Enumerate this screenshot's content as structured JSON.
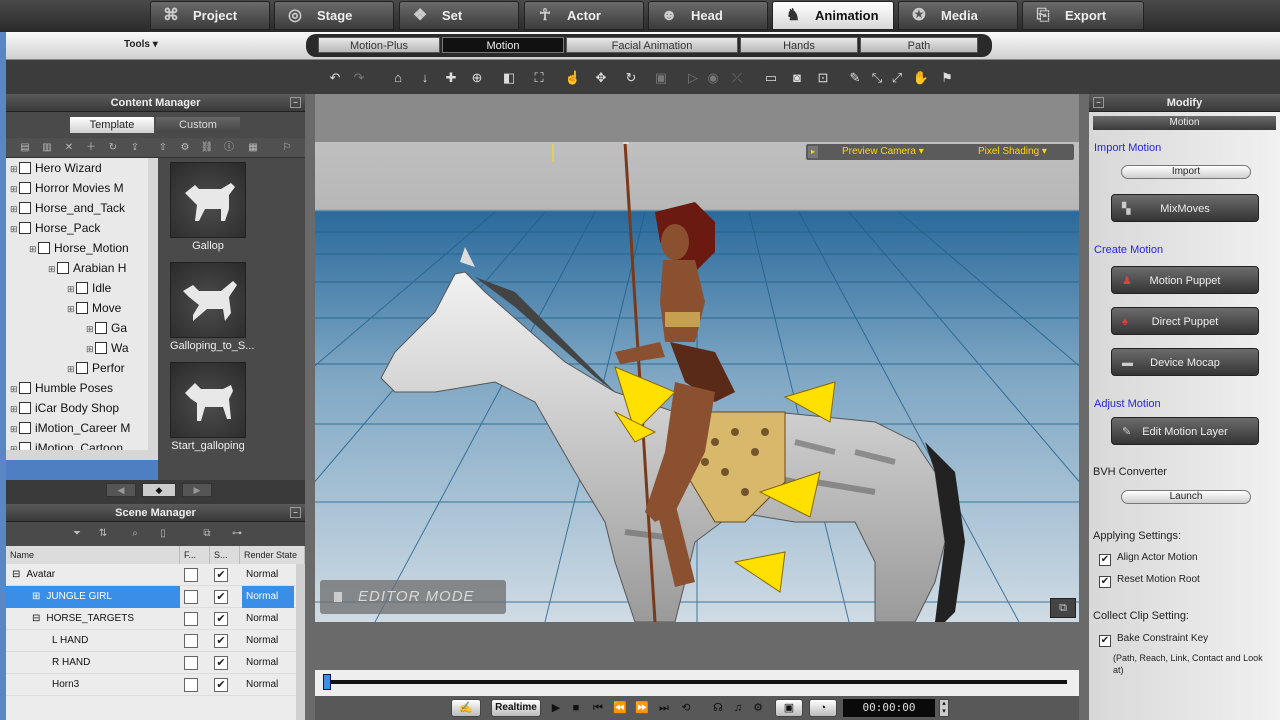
{
  "main_tabs": [
    {
      "label": "Project",
      "icon": "project-icon",
      "glyph": "⌘"
    },
    {
      "label": "Stage",
      "icon": "stage-icon",
      "glyph": "◎"
    },
    {
      "label": "Set",
      "icon": "set-icon",
      "glyph": "❖"
    },
    {
      "label": "Actor",
      "icon": "actor-icon",
      "glyph": "☥"
    },
    {
      "label": "Head",
      "icon": "head-icon",
      "glyph": "☻"
    },
    {
      "label": "Animation",
      "icon": "animation-icon",
      "glyph": "♞"
    },
    {
      "label": "Media",
      "icon": "media-icon",
      "glyph": "✪"
    },
    {
      "label": "Export",
      "icon": "export-icon",
      "glyph": "⎘"
    }
  ],
  "tools_label": "Tools ▾",
  "sub_tabs": [
    "Motion-Plus",
    "Motion",
    "Facial Animation",
    "Hands",
    "Path"
  ],
  "toolbar_icons": [
    {
      "name": "undo-icon",
      "glyph": "↶"
    },
    {
      "name": "redo-icon",
      "glyph": "↷"
    },
    {
      "name": "home-icon",
      "glyph": "⌂"
    },
    {
      "name": "drop-icon",
      "glyph": "↓"
    },
    {
      "name": "move-icon",
      "glyph": "✚"
    },
    {
      "name": "pivot-icon",
      "glyph": "⊕"
    },
    {
      "name": "scale-icon",
      "glyph": "◧"
    },
    {
      "name": "fit-icon",
      "glyph": "⛶"
    },
    {
      "name": "pick-icon",
      "glyph": "☝"
    },
    {
      "name": "translate-icon",
      "glyph": "✥"
    },
    {
      "name": "rotate-icon",
      "glyph": "↻"
    },
    {
      "name": "scale-disabled-icon",
      "glyph": "▣"
    },
    {
      "name": "play-dim-icon",
      "glyph": "▷"
    },
    {
      "name": "record-dim-icon",
      "glyph": "◉"
    },
    {
      "name": "link-dim-icon",
      "glyph": "⤫"
    },
    {
      "name": "camera-view-icon",
      "glyph": "▭"
    },
    {
      "name": "camera-icon",
      "glyph": "◙"
    },
    {
      "name": "zoom-fit-icon",
      "glyph": "⊡"
    },
    {
      "name": "brush-icon",
      "glyph": "✎"
    },
    {
      "name": "bone-icon",
      "glyph": "⤡"
    },
    {
      "name": "transform-icon",
      "glyph": "⤢"
    },
    {
      "name": "hand-icon",
      "glyph": "✋"
    },
    {
      "name": "flag-icon",
      "glyph": "⚑"
    }
  ],
  "content_manager": {
    "title": "Content Manager",
    "tab_template": "Template",
    "tab_custom": "Custom",
    "tree": [
      {
        "label": "Hero Wizard",
        "level": 0
      },
      {
        "label": "Horror Movies M",
        "level": 0
      },
      {
        "label": "Horse_and_Tack",
        "level": 0
      },
      {
        "label": "Horse_Pack",
        "level": 0
      },
      {
        "label": "Horse_Motion",
        "level": 1
      },
      {
        "label": "Arabian H",
        "level": 2
      },
      {
        "label": "Idle",
        "level": 3
      },
      {
        "label": "Move",
        "level": 3
      },
      {
        "label": "Ga",
        "level": 4
      },
      {
        "label": "Wa",
        "level": 4
      },
      {
        "label": "Perfor",
        "level": 3
      },
      {
        "label": "Humble Poses",
        "level": 0
      },
      {
        "label": "iCar Body Shop",
        "level": 0
      },
      {
        "label": "iMotion_Career M",
        "level": 0
      },
      {
        "label": "iMotion_Cartoon",
        "level": 0
      }
    ],
    "thumbnails": [
      "Gallop",
      "Galloping_to_S...",
      "Start_galloping"
    ]
  },
  "scene_manager": {
    "title": "Scene Manager",
    "columns": [
      "Name",
      "F...",
      "S...",
      "Render State"
    ],
    "rows": [
      {
        "name": "Avatar",
        "indent": 0,
        "f": false,
        "s": true,
        "render": "Normal",
        "selected": false,
        "prefix": "⊟"
      },
      {
        "name": "JUNGLE GIRL",
        "indent": 1,
        "f": false,
        "s": true,
        "render": "Normal",
        "selected": true,
        "prefix": "⊞"
      },
      {
        "name": "HORSE_TARGETS",
        "indent": 1,
        "f": false,
        "s": true,
        "render": "Normal",
        "selected": false,
        "prefix": "⊟"
      },
      {
        "name": "L HAND",
        "indent": 2,
        "f": false,
        "s": true,
        "render": "Normal",
        "selected": false,
        "prefix": ""
      },
      {
        "name": "R HAND",
        "indent": 2,
        "f": false,
        "s": true,
        "render": "Normal",
        "selected": false,
        "prefix": ""
      },
      {
        "name": "Horn3",
        "indent": 2,
        "f": false,
        "s": true,
        "render": "Normal",
        "selected": false,
        "prefix": ""
      }
    ]
  },
  "viewport": {
    "camera": "Preview Camera",
    "shading": "Pixel Shading",
    "mode": "EDITOR MODE"
  },
  "playback": {
    "realtime": "Realtime",
    "timecode": "00:00:00"
  },
  "modify": {
    "title": "Modify",
    "dropdown": "Motion",
    "import_motion": "Import Motion",
    "import_btn": "Import",
    "mixmoves_btn": "MixMoves",
    "create_motion": "Create Motion",
    "motion_puppet": "Motion Puppet",
    "direct_puppet": "Direct Puppet",
    "device_mocap": "Device Mocap",
    "adjust_motion": "Adjust Motion",
    "edit_motion_layer": "Edit Motion Layer",
    "bvh_converter": "BVH Converter",
    "launch_btn": "Launch",
    "applying_settings": "Applying Settings:",
    "align_actor_motion": "Align Actor Motion",
    "reset_motion_root": "Reset Motion Root",
    "collect_clip_setting": "Collect Clip Setting:",
    "bake_constraint_key": "Bake Constraint Key",
    "bake_note": "(Path, Reach, Link, Contact and Look at)"
  },
  "colors": {
    "accent_blue": "#3a8ee6",
    "section_blue": "#2626d4",
    "overlay_yellow": "#ffd800",
    "gizmo_yellow": "#ffe000"
  }
}
